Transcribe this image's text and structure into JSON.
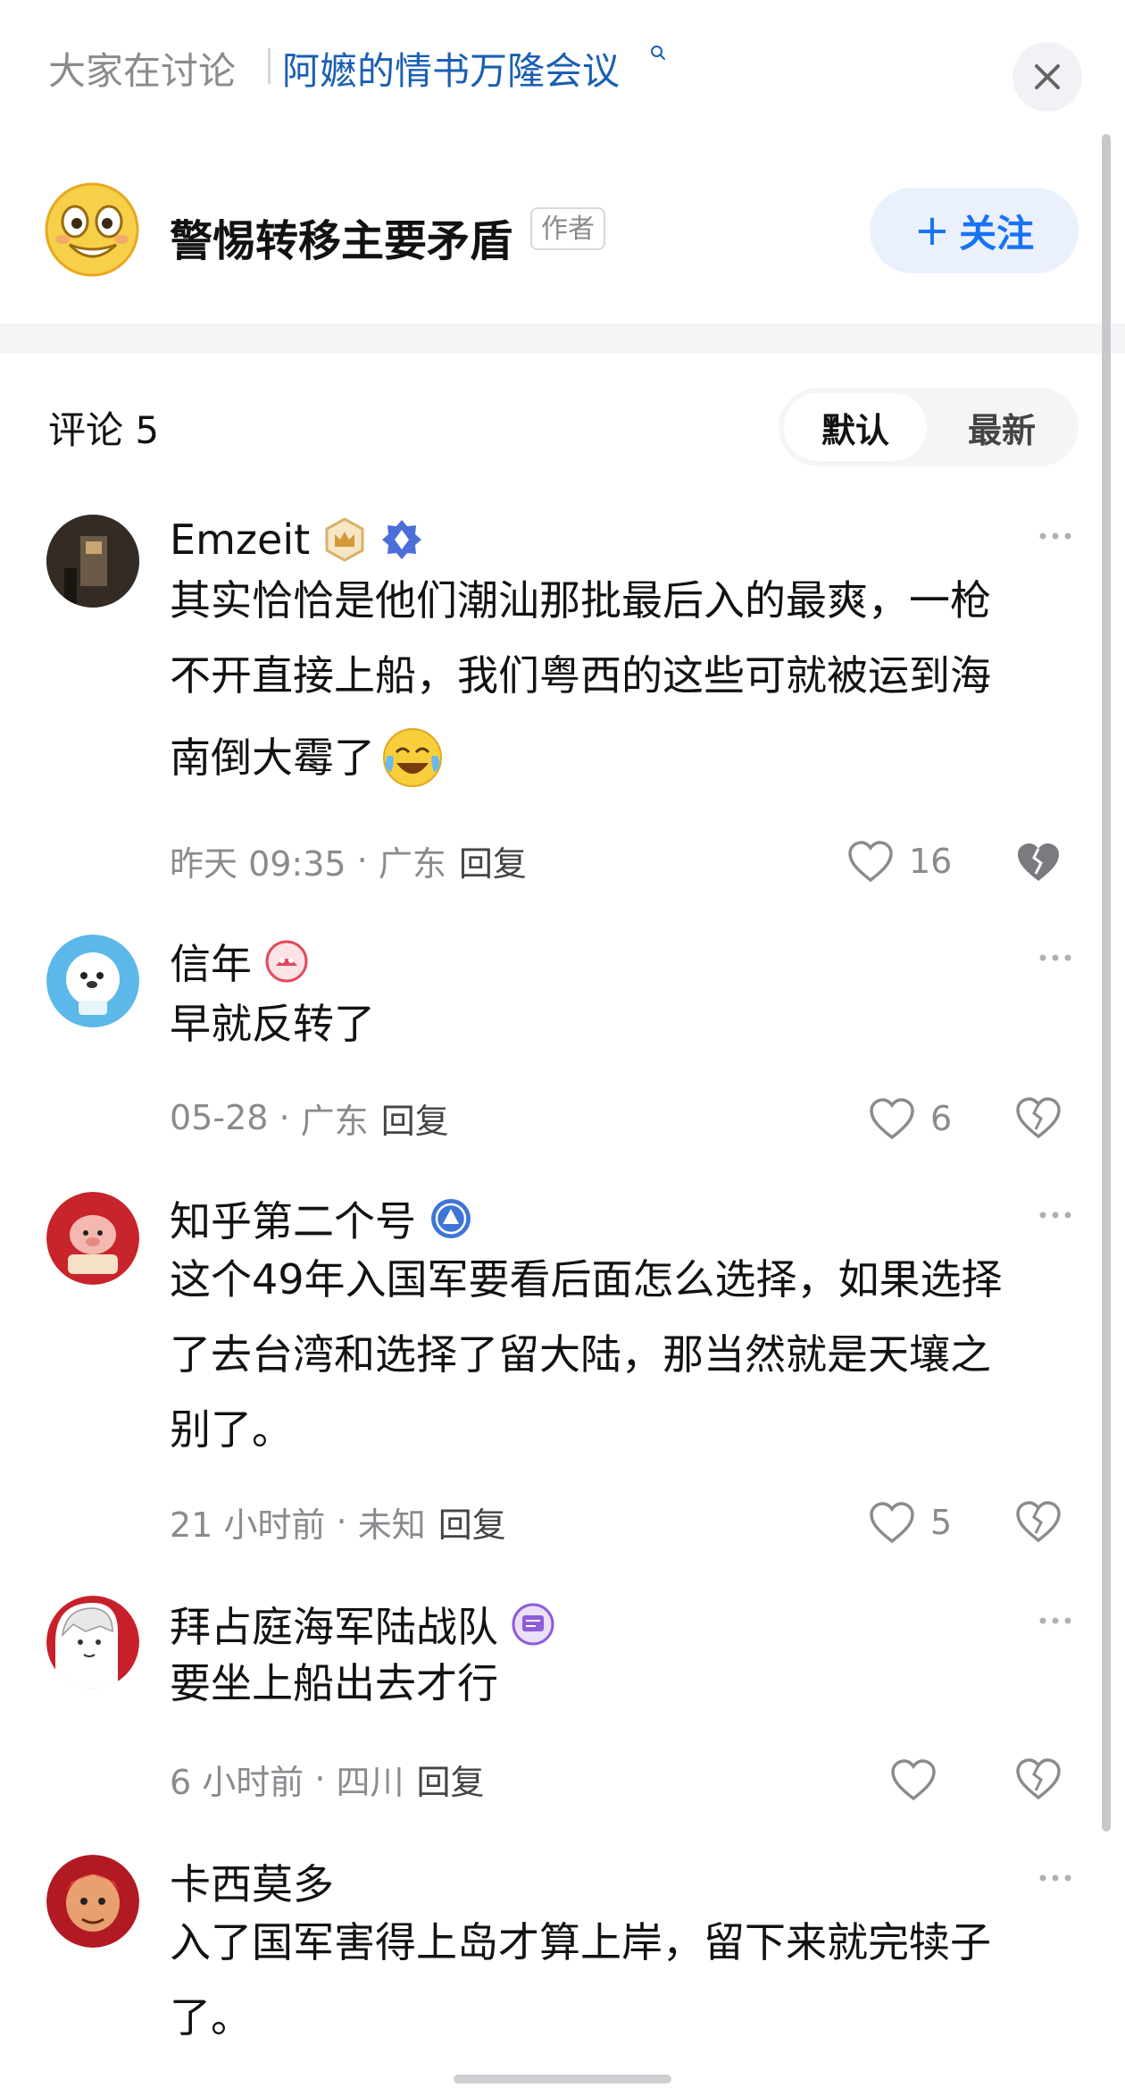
{
  "topbar": {
    "prefix": "大家在讨论",
    "topic": "阿嬷的情书万隆会议"
  },
  "author": {
    "name": "警惕转移主要矛盾",
    "tag": "作者",
    "follow_label": "关注"
  },
  "comments_header": {
    "title": "评论 5",
    "sort_default": "默认",
    "sort_latest": "最新"
  },
  "comments": [
    {
      "name": "Emzeit",
      "lines": [
        "其实恰恰是他们潮汕那批最后入的最爽，一枪",
        "不开直接上船，我们粤西的这些可就被运到海",
        "南倒大霉了"
      ],
      "time": "昨天 09:35",
      "location": "广东",
      "reply": "回复",
      "likes": "16"
    },
    {
      "name": "信年",
      "lines": [
        "早就反转了"
      ],
      "time": "05-28",
      "location": "广东",
      "reply": "回复",
      "likes": "6"
    },
    {
      "name": "知乎第二个号",
      "lines": [
        "这个49年入国军要看后面怎么选择，如果选择",
        "了去台湾和选择了留大陆，那当然就是天壤之",
        "别了。"
      ],
      "time": "21 小时前",
      "location": "未知",
      "reply": "回复",
      "likes": "5"
    },
    {
      "name": "拜占庭海军陆战队",
      "lines": [
        "要坐上船出去才行"
      ],
      "time": "6 小时前",
      "location": "四川",
      "reply": "回复",
      "likes": ""
    },
    {
      "name": "卡西莫多",
      "lines": [
        "入了国军害得上岛才算上岸，留下来就完犊子",
        "了。"
      ]
    }
  ],
  "icons": {
    "close": "close-icon",
    "search": "search-icon",
    "more": "more-dots-icon",
    "like": "heart-outline-icon",
    "dislike": "broken-heart-icon",
    "laugh_cry": "laugh-cry-emoji-icon"
  },
  "colors": {
    "accent": "#1772f6",
    "topic": "#1a5fb4",
    "muted": "#8a8a8f"
  }
}
